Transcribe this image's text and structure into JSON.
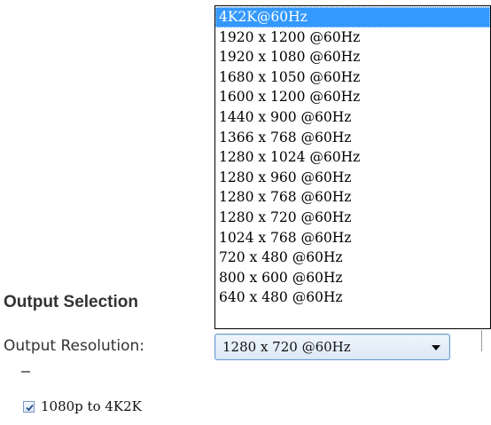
{
  "section": {
    "title": "Output Selection"
  },
  "output_resolution": {
    "label": "Output Resolution:",
    "selected_value": "1280 x 720 @60Hz",
    "highlighted_option": "4K2K@60Hz",
    "options": [
      "4K2K@60Hz",
      "1920 x 1200 @60Hz",
      "1920 x 1080 @60Hz",
      "1680 x 1050 @60Hz",
      "1600 x 1200 @60Hz",
      "1440 x 900 @60Hz",
      "1366 x 768 @60Hz",
      "1280 x 1024 @60Hz",
      "1280 x 960 @60Hz",
      "1280 x 768 @60Hz",
      "1280 x 720 @60Hz",
      "1024 x 768 @60Hz",
      "720 x 480 @60Hz",
      "800 x 600 @60Hz",
      "640 x 480 @60Hz"
    ]
  },
  "upscale_option": {
    "label": "1080p to 4K2K",
    "checked": true
  },
  "colors": {
    "highlight": "#3399ff",
    "select_border": "#6b9bd1",
    "text": "#333333"
  },
  "icons": {
    "dropdown": "chevron-down-icon",
    "checkbox_mark": "checkmark-icon"
  }
}
